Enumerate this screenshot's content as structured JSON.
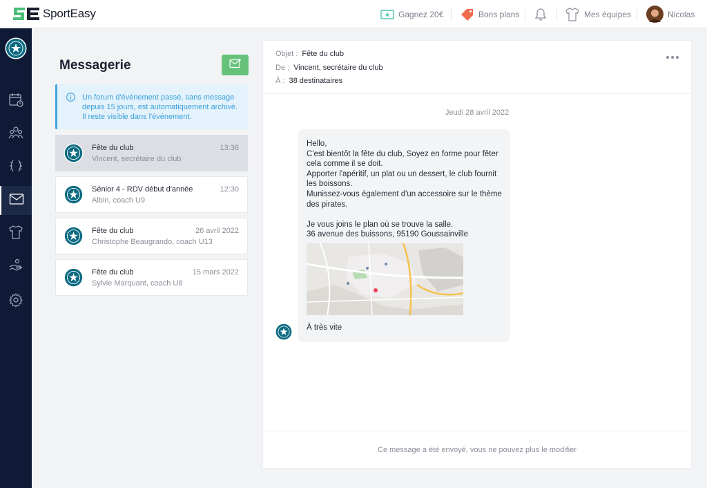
{
  "app": {
    "brand": "SportEasy"
  },
  "topbar": {
    "offer": "Gagnez 20€",
    "deals": "Bons plans",
    "teams": "Mes équipes",
    "user": "Nicolas"
  },
  "colors": {
    "sidebar": "#0e1a36",
    "accent": "#66c27a",
    "info": "#3fa6de",
    "deals": "#f06a4f"
  },
  "sidebar": {
    "items": [
      {
        "icon": "calendar-icon"
      },
      {
        "icon": "members-icon"
      },
      {
        "icon": "laurel-icon"
      },
      {
        "icon": "mail-icon",
        "active": true
      },
      {
        "icon": "shirt-icon"
      },
      {
        "icon": "handshake-icon"
      },
      {
        "icon": "settings-icon"
      }
    ]
  },
  "inbox": {
    "title": "Messagerie",
    "info": "Un forum d'événement passé, sans message depuis 15 jours, est automatiquement archivé. Il reste visible dans l'événement.",
    "conversations": [
      {
        "title": "Fête du club",
        "sender": "Vincent, secrétaire du club",
        "time": "13:36",
        "active": true
      },
      {
        "title": "Sénior 4 - RDV début d'année",
        "sender": "Albin, coach U9",
        "time": "12:30"
      },
      {
        "title": "Fête du club",
        "sender": "Christophe Beaugrando, coach U13",
        "time": "26 avril 2022"
      },
      {
        "title": "Fête du club",
        "sender": "Sylvie Marquant, coach U8",
        "time": "15 mars 2022"
      }
    ]
  },
  "message": {
    "subject_label": "Objet :",
    "subject": "Fête du club",
    "from_label": "De :",
    "from": "Vincent, secrétaire du club",
    "to_label": "À :",
    "to": "38 destinataires",
    "date": "Jeudi 28 avril 2022",
    "body": "Hello,\nC'est bientôt la fête du club, Soyez en forme pour fêter cela comme il se doit.\nApporter l'apéritif, un plat ou un dessert, le club fournit les boissons.\nMunissez-vous également d'un accessoire sur le thème des pirates.\n\nJe vous joins le plan où se trouve la salle.\n36 avenue des buissons, 95190 Goussainville",
    "closing": "À très vite",
    "footer": "Ce message a été envoyé, vous ne pouvez plus le modifier"
  }
}
